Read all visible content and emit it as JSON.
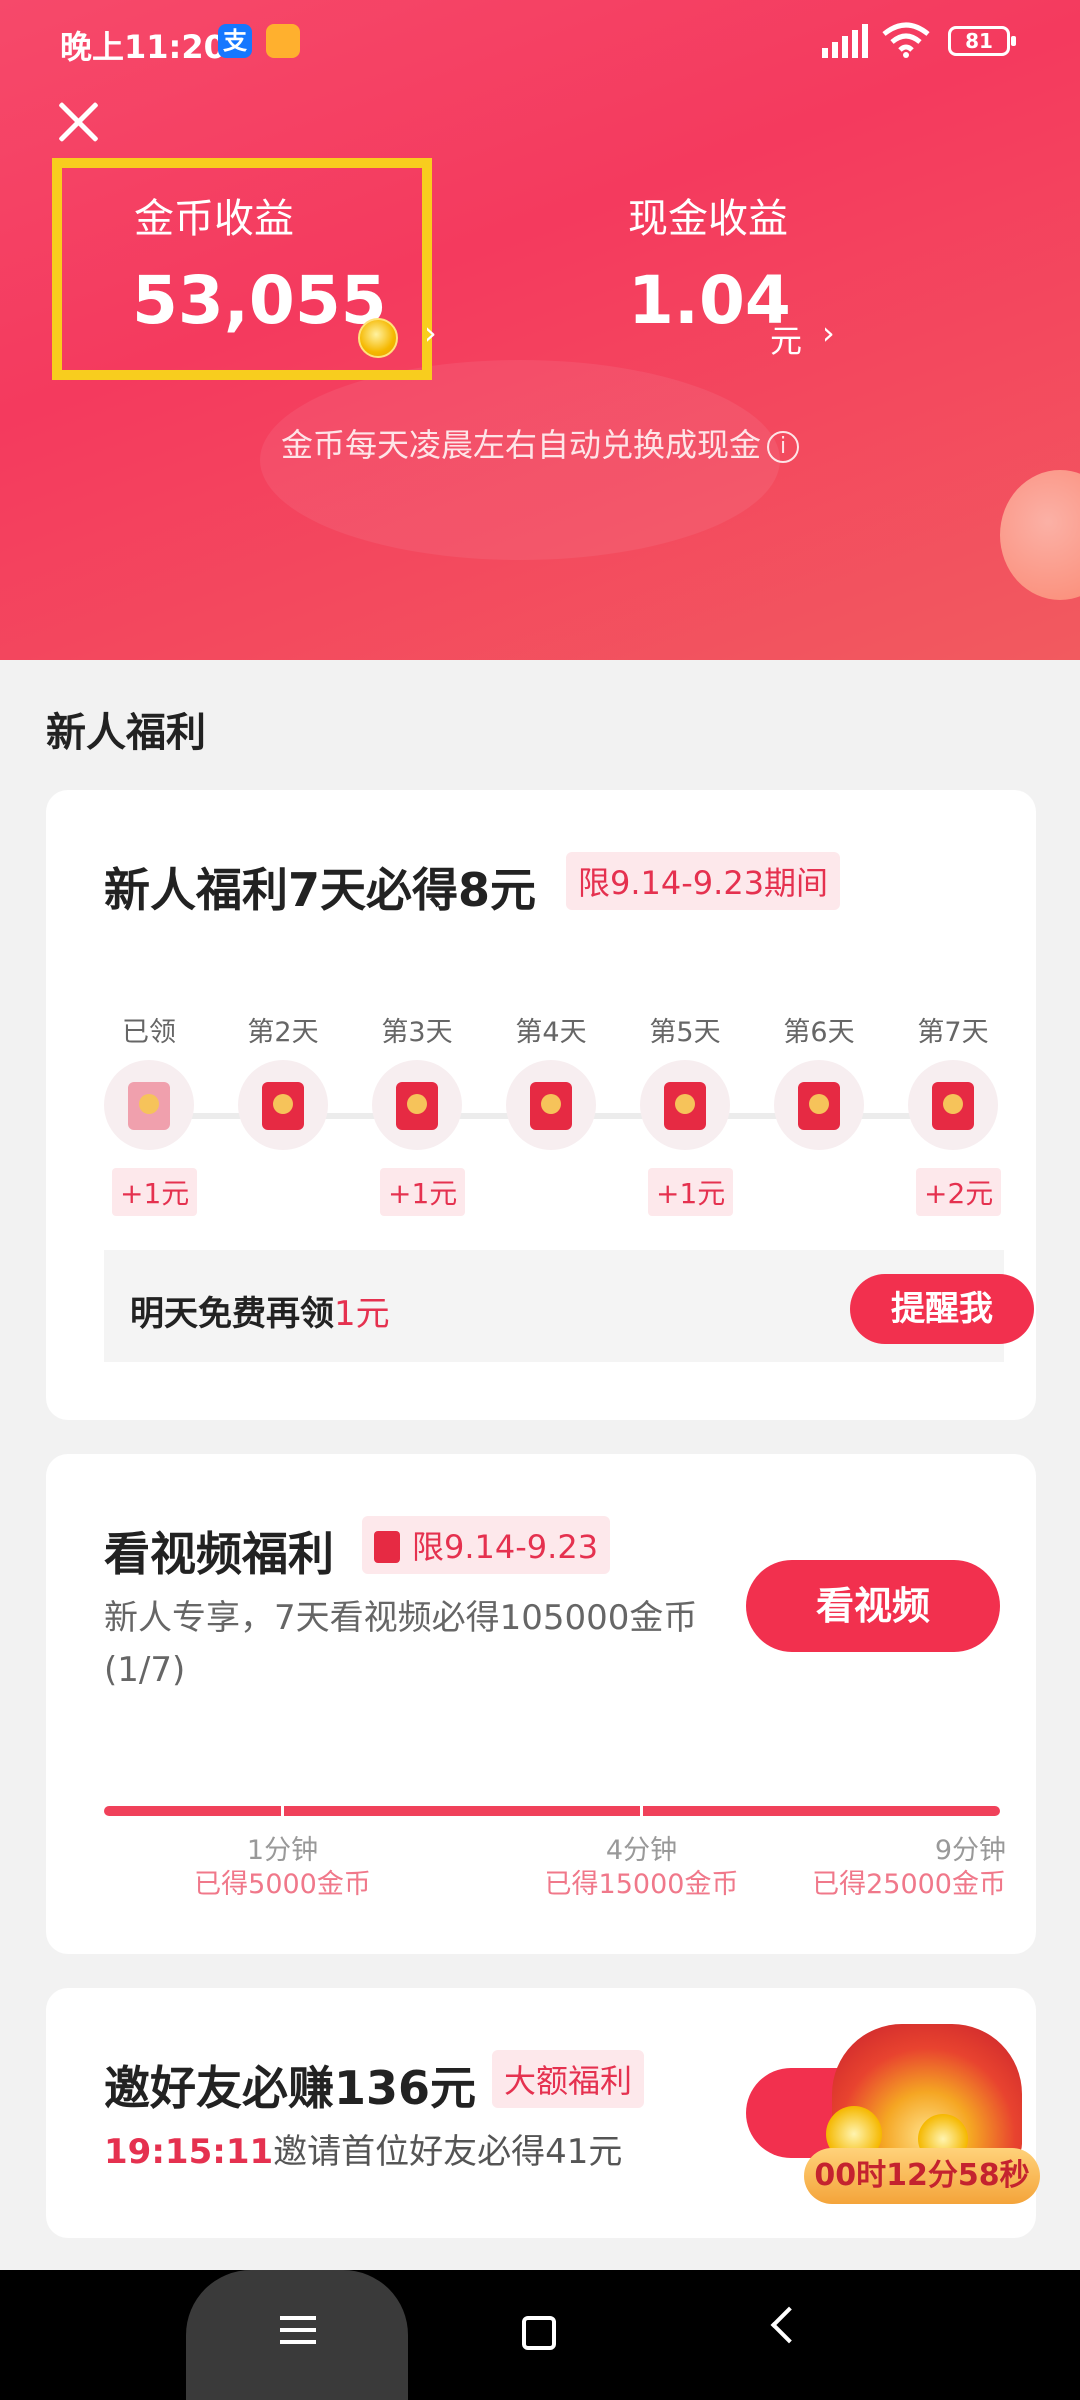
{
  "status_bar": {
    "time": "晚上11:20",
    "alipay_icon": "支",
    "battery": "81"
  },
  "header": {
    "coin_label": "金币收益",
    "coin_value": "53,055",
    "cash_label": "现金收益",
    "cash_value": "1.04",
    "cash_unit": "元",
    "hint": "金币每天凌晨左右自动兑换成现金",
    "colors": {
      "gradient_start": "#f6496a",
      "highlight_box": "#f8cd1e"
    }
  },
  "section_title": "新人福利",
  "newbie_card": {
    "title": "新人福利7天必得8元",
    "tag": "限9.14-9.23期间",
    "days": [
      "已领",
      "第2天",
      "第3天",
      "第4天",
      "第5天",
      "第6天",
      "第7天"
    ],
    "bonuses": [
      "+1元",
      "+1元",
      "+1元",
      "+2元"
    ],
    "tomorrow_text": "明天免费再领",
    "tomorrow_amount": "1元",
    "remind_button": "提醒我"
  },
  "video_card": {
    "title": "看视频福利",
    "tag": "限9.14-9.23",
    "subtitle": "新人专享，7天看视频必得105000金币(1/7)",
    "button": "看视频",
    "milestones": [
      {
        "time": "1分钟",
        "reward": "已得5000金币"
      },
      {
        "time": "4分钟",
        "reward": "已得15000金币"
      },
      {
        "time": "9分钟",
        "reward": "已得25000金币"
      }
    ]
  },
  "invite_card": {
    "title": "邀好友必赚136元",
    "tag": "大额福利",
    "countdown": "19:15:11",
    "subtitle": "邀请首位好友必得41元",
    "gift_timer": "00时12分58秒"
  },
  "accent_color": "#f2304e"
}
